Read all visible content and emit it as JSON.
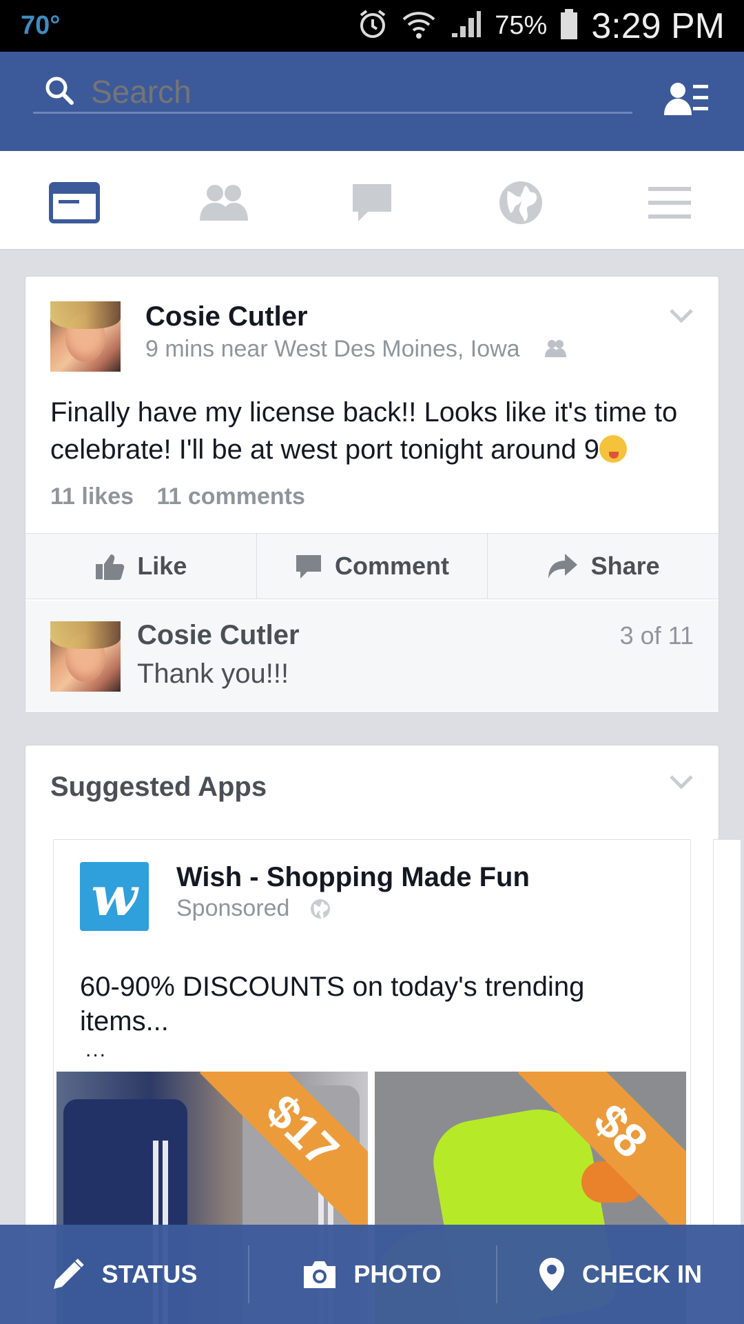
{
  "status_bar": {
    "temperature": "70°",
    "battery_pct": "75%",
    "time": "3:29 PM"
  },
  "search": {
    "placeholder": "Search"
  },
  "nav": {
    "tabs": [
      "news-feed",
      "friend-requests",
      "messages",
      "notifications",
      "more"
    ],
    "active": "news-feed"
  },
  "post": {
    "author": "Cosie Cutler",
    "meta": "9 mins near West Des Moines, Iowa",
    "text": "Finally have my license back!! Looks like it's time to celebrate! I'll be at west port tonight around 9",
    "likes": "11 likes",
    "comments": "11 comments",
    "actions": {
      "like": "Like",
      "comment": "Comment",
      "share": "Share"
    },
    "top_comment": {
      "author": "Cosie Cutler",
      "text": "Thank you!!!",
      "position": "3 of 11"
    }
  },
  "suggested_apps": {
    "title": "Suggested Apps",
    "ad": {
      "logo_letter": "w",
      "name": "Wish - Shopping Made Fun",
      "sponsored": "Sponsored",
      "text": "60-90% DISCOUNTS on today's trending items...",
      "more": "...",
      "products": [
        {
          "price": "$17"
        },
        {
          "price": "$8"
        }
      ]
    }
  },
  "bottom_bar": {
    "status": "STATUS",
    "photo": "PHOTO",
    "check_in": "CHECK IN"
  },
  "colors": {
    "brand_blue": "#3c5a9a",
    "price_orange": "#ec9b3b",
    "wish_blue": "#2fa0db"
  }
}
